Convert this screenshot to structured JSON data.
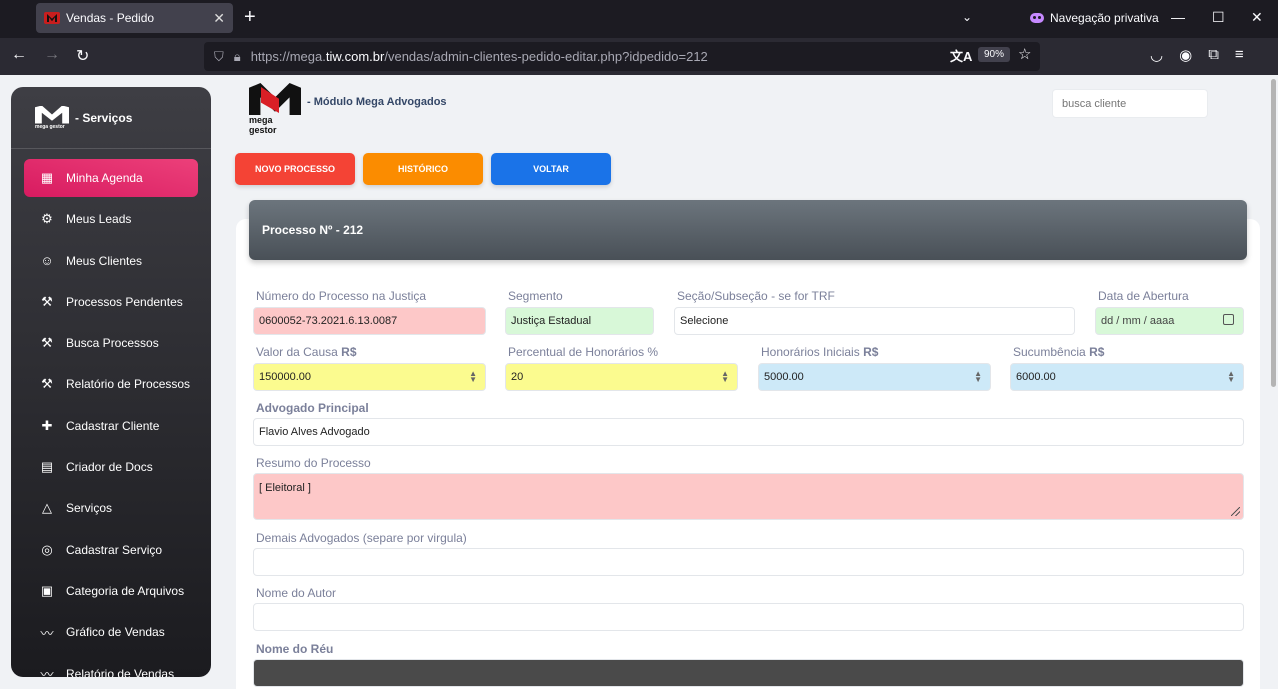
{
  "browser": {
    "tab_title": "Vendas - Pedido",
    "tab_close": "✕",
    "new_tab": "+",
    "private_label": "Navegação privativa",
    "url_prefix": "https://mega.",
    "url_domain": "tiw.com.br",
    "url_path": "/vendas/admin-clientes-pedido-editar.php?idpedido=212",
    "zoom": "90%"
  },
  "sidebar": {
    "brand_text": "- Serviços",
    "logo_subtext": "mega gestor",
    "items": [
      {
        "label": "Minha Agenda",
        "icon": "calendar-icon"
      },
      {
        "label": "Meus Leads",
        "icon": "user-cog-icon"
      },
      {
        "label": "Meus Clientes",
        "icon": "users-icon"
      },
      {
        "label": "Processos Pendentes",
        "icon": "gavel-icon"
      },
      {
        "label": "Busca Processos",
        "icon": "gavel-icon"
      },
      {
        "label": "Relatório de Processos",
        "icon": "gavel-icon"
      },
      {
        "label": "Cadastrar Cliente",
        "icon": "user-plus-icon"
      },
      {
        "label": "Criador de Docs",
        "icon": "doc-icon"
      },
      {
        "label": "Serviços",
        "icon": "shapes-icon"
      },
      {
        "label": "Cadastrar Serviço",
        "icon": "service-icon"
      },
      {
        "label": "Categoria de Arquivos",
        "icon": "folder-plus-icon"
      },
      {
        "label": "Gráfico de Vendas",
        "icon": "chart-icon"
      },
      {
        "label": "Relatório de Vendas",
        "icon": "chart-icon"
      }
    ]
  },
  "header": {
    "logo_text": "mega gestor",
    "title": "- Módulo Mega Advogados",
    "search_placeholder": "busca cliente"
  },
  "actions": {
    "novo_processo": "NOVO PROCESSO",
    "historico": "HISTÓRICO",
    "voltar": "VOLTAR"
  },
  "card": {
    "title": "Processo Nº - 212"
  },
  "form": {
    "numero_label": "Número do Processo na Justiça",
    "numero_value": "0600052-73.2021.6.13.0087",
    "segmento_label": "Segmento",
    "segmento_value": "Justiça Estadual",
    "secao_label": "Seção/Subseção - se for TRF",
    "secao_value": "Selecione",
    "data_label": "Data de Abertura",
    "data_value": "dd / mm / aaaa",
    "valor_label": "Valor da Causa",
    "valor_unit": "R$",
    "valor_value": "150000.00",
    "percentual_label": "Percentual de Honorários %",
    "percentual_value": "20",
    "honorarios_label": "Honorários Iniciais",
    "honorarios_unit": "R$",
    "honorarios_value": "5000.00",
    "sucumbencia_label": "Sucumbência",
    "sucumbencia_unit": "R$",
    "sucumbencia_value": "6000.00",
    "advogado_label": "Advogado Principal",
    "advogado_value": "Flavio Alves Advogado",
    "resumo_label": "Resumo do Processo",
    "resumo_value": "[ Eleitoral ]",
    "demais_label": "Demais Advogados (separe por virgula)",
    "demais_value": "",
    "autor_label": "Nome do Autor",
    "autor_value": "",
    "reu_label": "Nome do Réu",
    "reu_value": ""
  }
}
